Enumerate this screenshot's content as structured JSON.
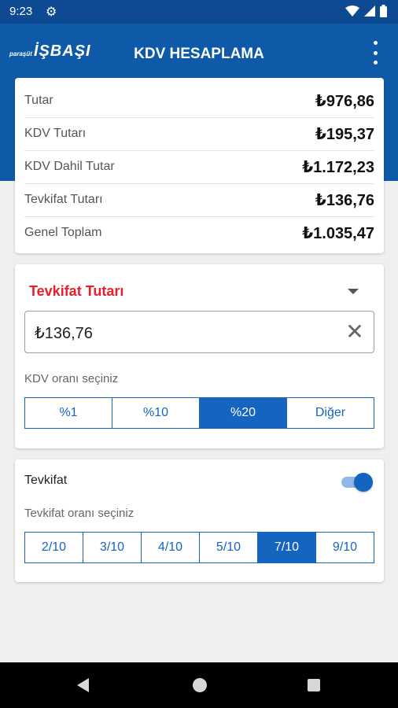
{
  "status_bar": {
    "time": "9:23"
  },
  "app": {
    "logo_small": "paraşüt",
    "logo_main": "İŞBAŞI",
    "title": "KDV HESAPLAMA"
  },
  "summary": {
    "rows": [
      {
        "label": "Tutar",
        "value": "₺976,86"
      },
      {
        "label": "KDV Tutarı",
        "value": "₺195,37"
      },
      {
        "label": "KDV Dahil Tutar",
        "value": "₺1.172,23"
      },
      {
        "label": "Tevkifat Tutarı",
        "value": "₺136,76"
      },
      {
        "label": "Genel Toplam",
        "value": "₺1.035,47"
      }
    ]
  },
  "calculator": {
    "title": "Tevkifat Tutarı",
    "amount_value": "₺136,76",
    "kdv_label": "KDV oranı seçiniz",
    "kdv_options": [
      "%1",
      "%10",
      "%20",
      "Diğer"
    ],
    "kdv_selected": "%20"
  },
  "tevkifat": {
    "label": "Tevkifat",
    "enabled": true,
    "rate_label": "Tevkifat oranı seçiniz",
    "rate_options": [
      "2/10",
      "3/10",
      "4/10",
      "5/10",
      "7/10",
      "9/10"
    ],
    "rate_selected": "7/10"
  },
  "colors": {
    "primary": "#1565c0",
    "header": "#0f5aa8",
    "accent_red": "#e8202a"
  },
  "icons": {
    "settings": "gear-icon",
    "wifi": "wifi-icon",
    "signal": "signal-icon",
    "battery": "battery-icon",
    "menu": "overflow-menu-icon",
    "dropdown": "dropdown-arrow-icon",
    "clear": "close-icon",
    "nav_back": "back-icon",
    "nav_home": "home-icon",
    "nav_recents": "recents-icon"
  }
}
